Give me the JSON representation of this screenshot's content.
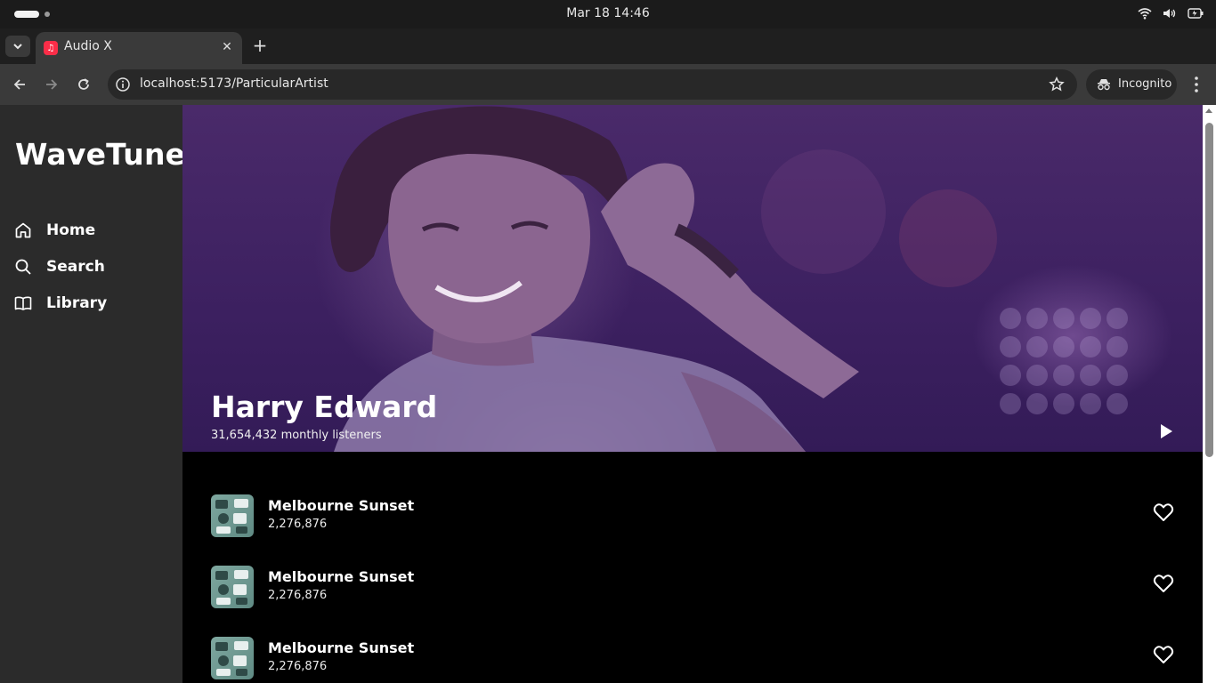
{
  "os": {
    "clock": "Mar 18  14:46",
    "icons": [
      "wifi-icon",
      "volume-icon",
      "battery-icon"
    ]
  },
  "browser": {
    "tab_title": "Audio X",
    "url": "localhost:5173/ParticularArtist",
    "incognito_label": "Incognito"
  },
  "sidebar": {
    "logo": "WaveTune",
    "items": [
      {
        "label": "Home",
        "icon": "home-icon"
      },
      {
        "label": "Search",
        "icon": "search-icon"
      },
      {
        "label": "Library",
        "icon": "book-icon"
      }
    ]
  },
  "artist": {
    "name": "Harry Edward",
    "listeners": "31,654,432 monthly listeners"
  },
  "tracks": [
    {
      "title": "Melbourne Sunset",
      "plays": "2,276,876"
    },
    {
      "title": "Melbourne Sunset",
      "plays": "2,276,876"
    },
    {
      "title": "Melbourne Sunset",
      "plays": "2,276,876"
    }
  ],
  "colors": {
    "sidebar_bg": "#2b2b2b",
    "main_bg": "#000000",
    "hero_tint": "#3c2060",
    "accent": "#ffffff"
  }
}
